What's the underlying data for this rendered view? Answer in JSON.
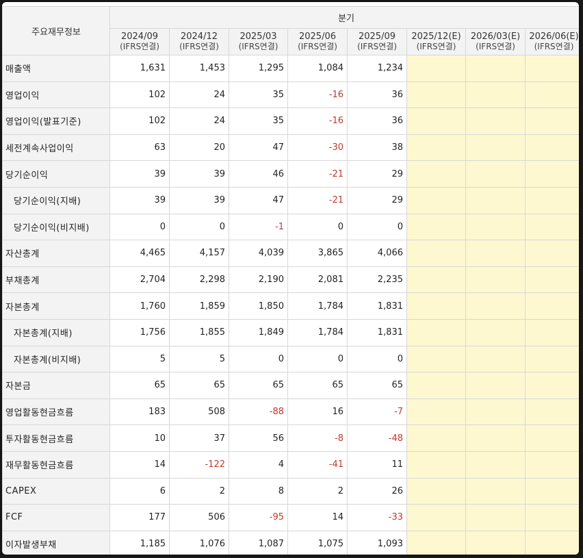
{
  "table": {
    "corner_label": "주요재무정보",
    "group_label": "분기",
    "periods": [
      {
        "label": "2024/09",
        "sub": "(IFRS연결)"
      },
      {
        "label": "2024/12",
        "sub": "(IFRS연결)"
      },
      {
        "label": "2025/03",
        "sub": "(IFRS연결)"
      },
      {
        "label": "2025/06",
        "sub": "(IFRS연결)"
      },
      {
        "label": "2025/09",
        "sub": "(IFRS연결)"
      },
      {
        "label": "2025/12(E)",
        "sub": "(IFRS연결)"
      },
      {
        "label": "2026/03(E)",
        "sub": "(IFRS연결)"
      },
      {
        "label": "2026/06(E)",
        "sub": "(IFRS연결)"
      }
    ],
    "rows": [
      {
        "label": "매출액",
        "indent": false,
        "values": [
          "1,631",
          "1,453",
          "1,295",
          "1,084",
          "1,234"
        ]
      },
      {
        "label": "영업이익",
        "indent": false,
        "values": [
          "102",
          "24",
          "35",
          "-16",
          "36"
        ]
      },
      {
        "label": "영업이익(발표기준)",
        "indent": false,
        "values": [
          "102",
          "24",
          "35",
          "-16",
          "36"
        ]
      },
      {
        "label": "세전계속사업이익",
        "indent": false,
        "values": [
          "63",
          "20",
          "47",
          "-30",
          "38"
        ]
      },
      {
        "label": "당기순이익",
        "indent": false,
        "values": [
          "39",
          "39",
          "46",
          "-21",
          "29"
        ]
      },
      {
        "label": "당기순이익(지배)",
        "indent": true,
        "values": [
          "39",
          "39",
          "47",
          "-21",
          "29"
        ]
      },
      {
        "label": "당기순이익(비지배)",
        "indent": true,
        "values": [
          "0",
          "0",
          "-1",
          "0",
          "0"
        ]
      },
      {
        "label": "자산총계",
        "indent": false,
        "values": [
          "4,465",
          "4,157",
          "4,039",
          "3,865",
          "4,066"
        ]
      },
      {
        "label": "부채총계",
        "indent": false,
        "values": [
          "2,704",
          "2,298",
          "2,190",
          "2,081",
          "2,235"
        ]
      },
      {
        "label": "자본총계",
        "indent": false,
        "values": [
          "1,760",
          "1,859",
          "1,850",
          "1,784",
          "1,831"
        ]
      },
      {
        "label": "자본총계(지배)",
        "indent": true,
        "values": [
          "1,756",
          "1,855",
          "1,849",
          "1,784",
          "1,831"
        ]
      },
      {
        "label": "자본총계(비지배)",
        "indent": true,
        "values": [
          "5",
          "5",
          "0",
          "0",
          "0"
        ]
      },
      {
        "label": "자본금",
        "indent": false,
        "values": [
          "65",
          "65",
          "65",
          "65",
          "65"
        ]
      },
      {
        "label": "영업활동현금흐름",
        "indent": false,
        "values": [
          "183",
          "508",
          "-88",
          "16",
          "-7"
        ]
      },
      {
        "label": "투자활동현금흐름",
        "indent": false,
        "values": [
          "10",
          "37",
          "56",
          "-8",
          "-48"
        ]
      },
      {
        "label": "재무활동현금흐름",
        "indent": false,
        "values": [
          "14",
          "-122",
          "4",
          "-41",
          "11"
        ]
      },
      {
        "label": "CAPEX",
        "indent": false,
        "values": [
          "6",
          "2",
          "8",
          "2",
          "26"
        ]
      },
      {
        "label": "FCF",
        "indent": false,
        "values": [
          "177",
          "506",
          "-95",
          "14",
          "-33"
        ]
      },
      {
        "label": "이자발생부채",
        "indent": false,
        "values": [
          "1,185",
          "1,076",
          "1,087",
          "1,075",
          "1,093"
        ]
      }
    ]
  },
  "colors": {
    "negative": "#c0392b",
    "estimate_fill": "#fdf8d0",
    "header_fill": "#f3f3f3"
  }
}
